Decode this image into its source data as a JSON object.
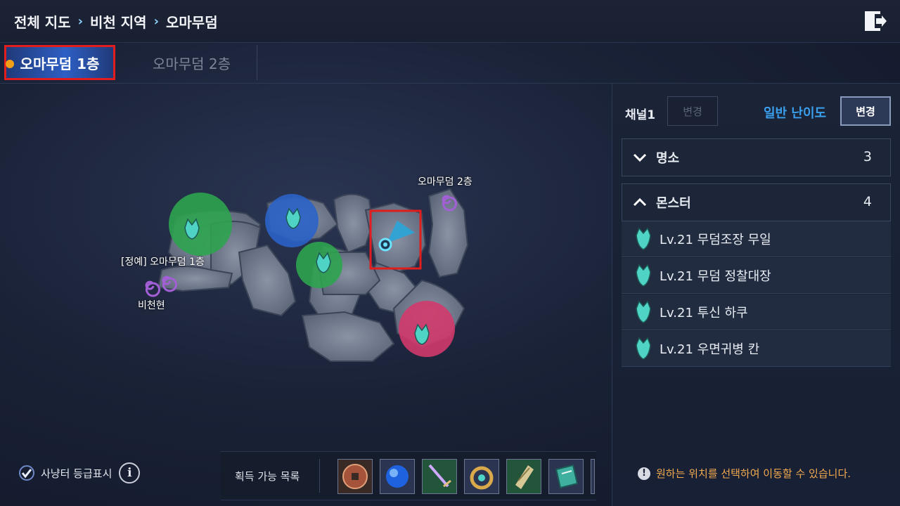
{
  "breadcrumb": [
    "전체 지도",
    "비천 지역",
    "오마무덤"
  ],
  "breadcrumb_sep": "›",
  "tabs": [
    {
      "label": "오마무덤 1층",
      "active": true
    },
    {
      "label": "오마무덤 2층",
      "active": false
    }
  ],
  "map": {
    "labels": {
      "floor2_portal": "오마무덤 2층",
      "elite_floor1": "[정예] 오마무덤 1층",
      "bichunhyun": "비천현"
    },
    "zone_colors": {
      "green": "#2ea44f",
      "blue": "#2b63c8",
      "red": "#d23a6b"
    }
  },
  "channel": {
    "label": "채널1",
    "change_label": "변경"
  },
  "difficulty": {
    "label": "일반 난이도",
    "change_label": "변경"
  },
  "sections": {
    "places": {
      "label": "명소",
      "count": "3"
    },
    "monsters": {
      "label": "몬스터",
      "count": "4",
      "items": [
        {
          "name": "Lv.21 무덤조장 무일"
        },
        {
          "name": "Lv.21 무덤 정찰대장"
        },
        {
          "name": "Lv.21 투신 하쿠"
        },
        {
          "name": "Lv.21 우면귀병 칸"
        }
      ]
    }
  },
  "notice": {
    "icon": "!",
    "text": "원하는 위치를 선택하여 이동할 수 있습니다."
  },
  "hunting_grade": {
    "label": "사냥터 등급표시",
    "checked": true
  },
  "loot": {
    "label": "획득 가능 목록",
    "items": [
      "coin-icon",
      "blue-orb-icon",
      "sword-icon",
      "amulet-icon",
      "scroll-icon",
      "book-icon"
    ]
  },
  "accent": {
    "orange": "#f3a94e",
    "blue": "#3aa0ee",
    "highlight_red": "#e11d1d"
  }
}
